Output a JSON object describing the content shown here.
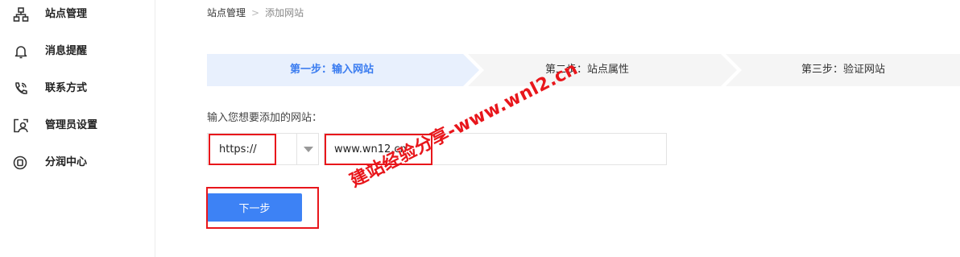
{
  "sidebar": {
    "items": [
      {
        "label": "站点管理",
        "icon": "sitemap-icon"
      },
      {
        "label": "消息提醒",
        "icon": "bell-icon"
      },
      {
        "label": "联系方式",
        "icon": "phone-icon"
      },
      {
        "label": "管理员设置",
        "icon": "admin-user-icon"
      },
      {
        "label": "分润中心",
        "icon": "coin-icon"
      }
    ]
  },
  "breadcrumb": {
    "home": "站点管理",
    "separator": ">",
    "current": "添加网站"
  },
  "steps": [
    {
      "label": "第一步：输入网站",
      "active": true
    },
    {
      "label": "第二步：站点属性",
      "active": false
    },
    {
      "label": "第三步：验证网站",
      "active": false
    }
  ],
  "form": {
    "label": "输入您想要添加的网站：",
    "protocol": "https://",
    "site_value": "www.wn12.cn",
    "next_label": "下一步"
  },
  "watermark": "建站经验分享-www.wnl2.cn",
  "colors": {
    "accent": "#3d82f5",
    "active_step_bg": "#e8f0fd",
    "inactive_step_bg": "#f5f5f5",
    "highlight": "#e8161b"
  }
}
